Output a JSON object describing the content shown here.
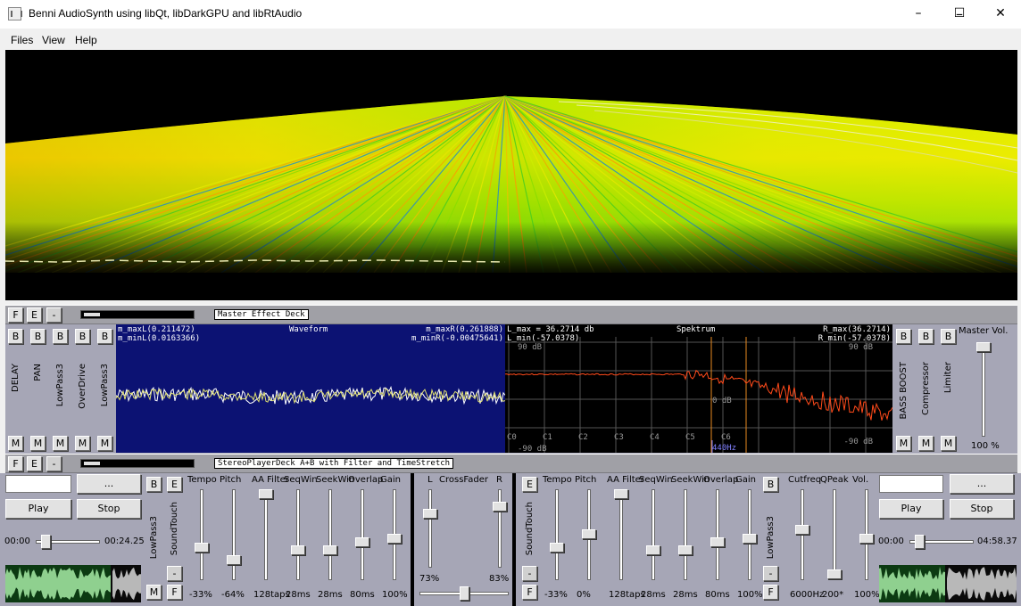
{
  "window": {
    "title": "Benni AudioSynth using libQt, libDarkGPU and libRtAudio",
    "min_glyph": "–",
    "max_glyph": "☐",
    "close_glyph": "✕"
  },
  "menu": [
    "Files",
    "View",
    "Help"
  ],
  "master_deck": {
    "name": "Master Effect Deck",
    "f_label": "F",
    "e_label": "E",
    "dash_label": "-",
    "left_effects": [
      "DELAY",
      "PAN",
      "LowPass3",
      "OverDrive",
      "LowPass3"
    ],
    "right_effects": [
      "BASS BOOST",
      "Compressor",
      "Limiter"
    ],
    "b_label": "B",
    "m_label": "M",
    "waveform": {
      "title": "Waveform",
      "max_l": "m_maxL(0.211472)",
      "min_l": "m_minL(0.0163366)",
      "max_r": "m_maxR(0.261888)",
      "min_r": "m_minR(-0.00475641)"
    },
    "spectrum": {
      "title": "Spektrum",
      "l_max": "L_max = 36.2714 db",
      "l_min": "L_min(-57.0378)",
      "r_max": "R_max(36.2714)",
      "r_min": "R_min(-57.0378)",
      "db_top_left": "90 dB",
      "db_top_right": "90 dB",
      "db_mid": "0 dB",
      "db_bottom_left": "-90 dB",
      "db_bottom_right": "-90 dB",
      "octaves": [
        "C0",
        "C1",
        "C2",
        "C3",
        "C4",
        "C5",
        "C6"
      ],
      "freq_marker": "440Hz"
    },
    "master_vol": {
      "label": "Master Vol.",
      "value": "100 %",
      "level": 1.0
    }
  },
  "player_deck": {
    "name": "StereoPlayerDeck A+B with Filter and TimeStretch",
    "f_label": "F",
    "e_label": "E",
    "dash_label": "-",
    "dots": "...",
    "play": "Play",
    "stop": "Stop",
    "a": {
      "time_start": "00:00",
      "time_end": "00:24.25",
      "position": 0.1
    },
    "b": {
      "time_start": "00:00",
      "time_end": "04:58.37",
      "position": 0.1
    },
    "b_label": "B",
    "e2_label": "E",
    "m_label": "M",
    "f2_label": "F",
    "lowpass": "LowPass3",
    "soundtouch": "SoundTouch",
    "left_sliders": [
      {
        "label": "Tempo",
        "value": "-33%",
        "level": 0.33
      },
      {
        "label": "Pitch",
        "value": "-64%",
        "level": 0.18
      },
      {
        "label": "AA Filter",
        "value": "128taps",
        "level": 1.0
      },
      {
        "label": "SeqWin",
        "value": "28ms",
        "level": 0.3
      },
      {
        "label": "SeekWin",
        "value": "28ms",
        "level": 0.3
      },
      {
        "label": "Overlap",
        "value": "80ms",
        "level": 0.4
      },
      {
        "label": "Gain",
        "value": "100%",
        "level": 0.45
      }
    ],
    "crossfader": {
      "label": "CrossFader",
      "l": "L",
      "r": "R",
      "l_value": "73%",
      "r_value": "83%",
      "l_level": 0.73,
      "r_level": 0.83
    },
    "right_sliders": [
      {
        "label": "Tempo",
        "value": "-33%",
        "level": 0.33
      },
      {
        "label": "Pitch",
        "value": "0%",
        "level": 0.5
      },
      {
        "label": "AA Filter",
        "value": "128taps",
        "level": 1.0
      },
      {
        "label": "SeqWin",
        "value": "28ms",
        "level": 0.3
      },
      {
        "label": "SeekWin",
        "value": "28ms",
        "level": 0.3
      },
      {
        "label": "Overlap",
        "value": "80ms",
        "level": 0.4
      },
      {
        "label": "Gain",
        "value": "100%",
        "level": 0.45
      }
    ],
    "filter_sliders": [
      {
        "label": "Cutfreq",
        "value": "6000Hz",
        "level": 0.55
      },
      {
        "label": "QPeak",
        "value": "200*",
        "level": 0.0
      },
      {
        "label": "Vol.",
        "value": "100%",
        "level": 0.45
      }
    ]
  },
  "colors": {
    "panel": "#a6a6b6",
    "waveform_bg": "#0c1273",
    "spectrum_bg": "#000000",
    "spectrum_line": "#ff4a1a",
    "terrain_yellow": "#e6e600",
    "terrain_green": "#44dd22",
    "terrain_orange": "#ee8800"
  }
}
